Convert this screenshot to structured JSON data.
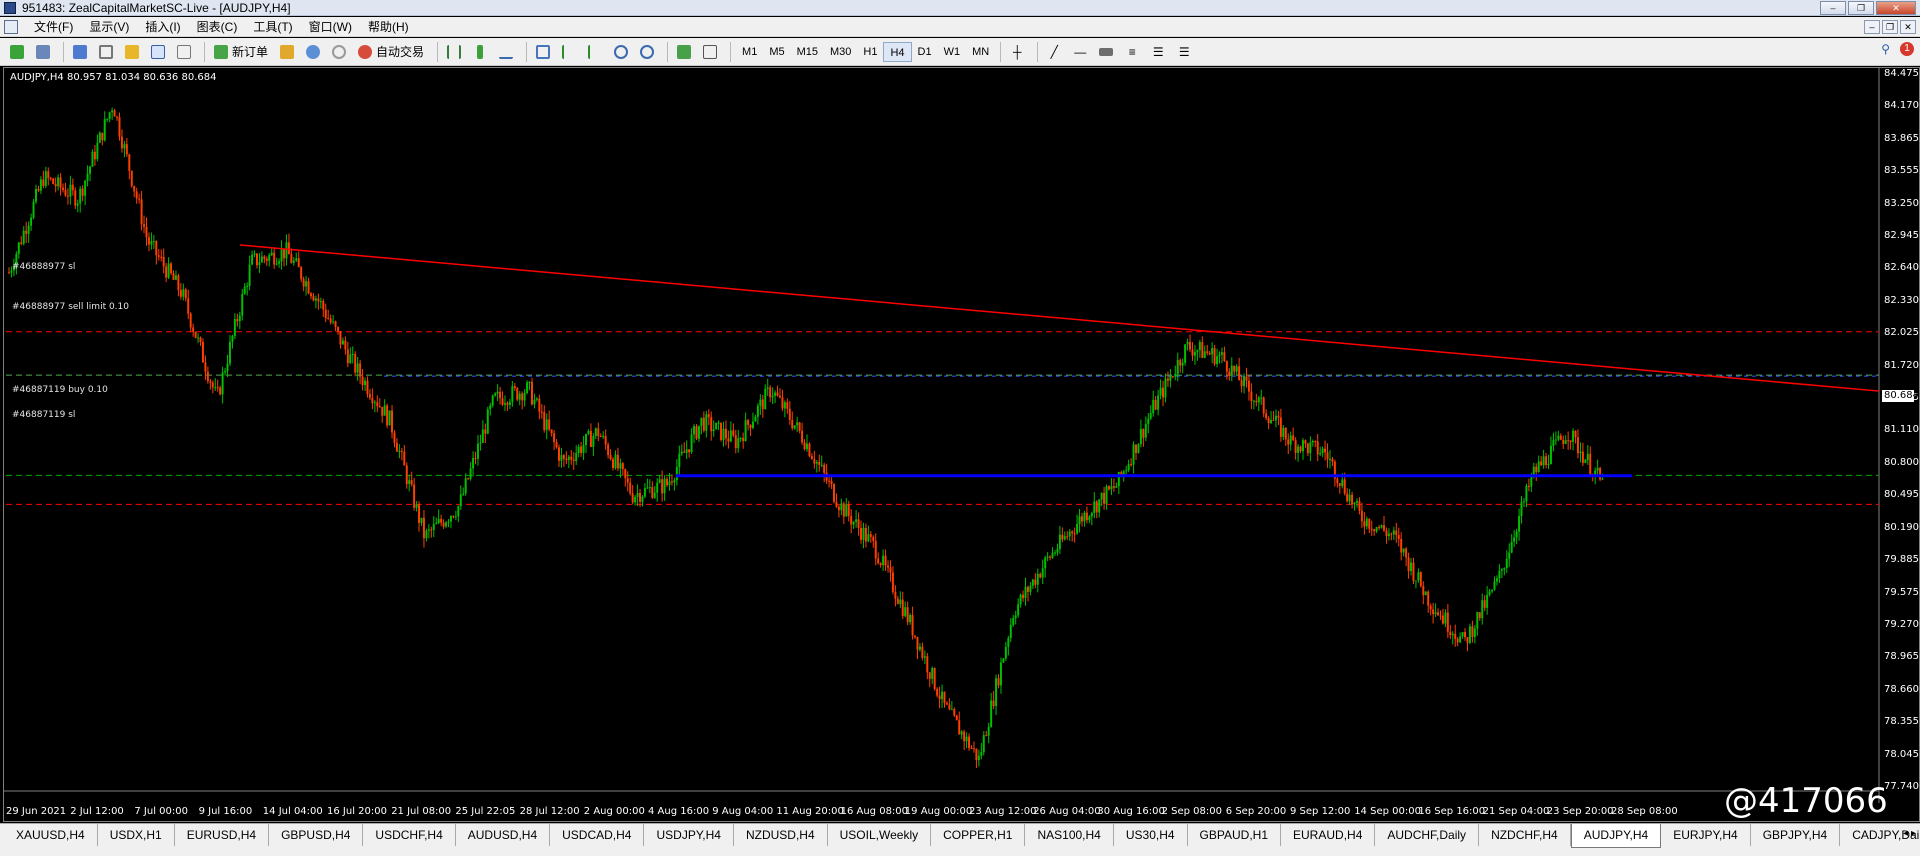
{
  "window": {
    "title": "951483: ZealCapitalMarketSC-Live - [AUDJPY,H4]",
    "buttons": [
      "–",
      "❐",
      "✕"
    ]
  },
  "menu": [
    "文件(F)",
    "显示(V)",
    "插入(I)",
    "图表(C)",
    "工具(T)",
    "窗口(W)",
    "帮助(H)"
  ],
  "toolbar": {
    "new_order": "新订单",
    "auto_trading": "自动交易",
    "timeframes": [
      "M1",
      "M5",
      "M15",
      "M30",
      "H1",
      "H4",
      "D1",
      "W1",
      "MN"
    ],
    "active_timeframe": "H4",
    "notification_count": "1"
  },
  "chart": {
    "info": "AUDJPY,H4  80.957 81.034 80.636 80.684",
    "current_price": "80.684",
    "order_labels": [
      {
        "text": "#46888977 sl"
      },
      {
        "text": "#46888977 sell limit 0.10"
      },
      {
        "text": "#46887119 buy 0.10"
      },
      {
        "text": "#46887119 sl"
      }
    ],
    "price_ticks": [
      "84.475",
      "84.170",
      "83.865",
      "83.555",
      "83.250",
      "82.945",
      "82.640",
      "82.330",
      "82.025",
      "81.720",
      "81.415",
      "81.110",
      "80.800",
      "80.495",
      "80.190",
      "79.885",
      "79.575",
      "79.270",
      "78.965",
      "78.660",
      "78.355",
      "78.045",
      "77.740"
    ],
    "time_ticks": [
      "29 Jun 2021",
      "2 Jul 12:00",
      "7 Jul 00:00",
      "9 Jul 16:00",
      "14 Jul 04:00",
      "16 Jul 20:00",
      "21 Jul 08:00",
      "25 Jul 22:05",
      "28 Jul 12:00",
      "2 Aug 00:00",
      "4 Aug 16:00",
      "9 Aug 04:00",
      "11 Aug 20:00",
      "16 Aug 08:00",
      "19 Aug 00:00",
      "23 Aug 12:00",
      "26 Aug 04:00",
      "30 Aug 16:00",
      "2 Sep 08:00",
      "6 Sep 20:00",
      "9 Sep 12:00",
      "14 Sep 00:00",
      "16 Sep 16:00",
      "21 Sep 04:00",
      "23 Sep 20:00",
      "28 Sep 08:00"
    ],
    "watermark": "@417066",
    "colors": {
      "bull": "#00c000",
      "bear": "#ff4000",
      "trendline": "#ff0000",
      "support": "#0000ff",
      "sl": "#ff0000",
      "entry": "#00aa00"
    }
  },
  "chart_data": {
    "type": "candlestick",
    "symbol": "AUDJPY",
    "timeframe": "H4",
    "ylim": [
      77.74,
      84.475
    ],
    "path_prices": [
      82.6,
      83.5,
      83.3,
      84.2,
      82.9,
      82.4,
      81.4,
      82.7,
      82.8,
      82.3,
      81.7,
      81.2,
      80.1,
      80.4,
      81.4,
      81.5,
      80.8,
      81.1,
      80.5,
      80.6,
      81.2,
      81.0,
      81.5,
      81.0,
      80.4,
      80.0,
      79.3,
      78.5,
      78.0,
      79.4,
      79.9,
      80.3,
      80.6,
      81.3,
      81.9,
      81.8,
      81.4,
      81.0,
      80.9,
      80.3,
      80.1,
      79.5,
      79.1,
      79.7,
      80.7,
      81.1,
      80.6
    ],
    "sl_sell": 82.04,
    "sell_limit": 81.63,
    "buy_entry": 80.684,
    "sl_buy": 80.41,
    "support_level": 80.68,
    "trendline": {
      "from": 82.86,
      "to": 81.48
    }
  },
  "tabs": [
    "XAUUSD,H4",
    "USDX,H1",
    "EURUSD,H4",
    "GBPUSD,H4",
    "USDCHF,H4",
    "AUDUSD,H4",
    "USDCAD,H4",
    "USDJPY,H4",
    "NZDUSD,H4",
    "USOIL,Weekly",
    "COPPER,H1",
    "NAS100,H4",
    "US30,H4",
    "GBPAUD,H1",
    "EURAUD,H4",
    "AUDCHF,Daily",
    "NZDCHF,H4",
    "AUDJPY,H4",
    "EURJPY,H4",
    "GBPJPY,H4",
    "CADJPY,Daily"
  ],
  "active_tab": "AUDJPY,H4"
}
